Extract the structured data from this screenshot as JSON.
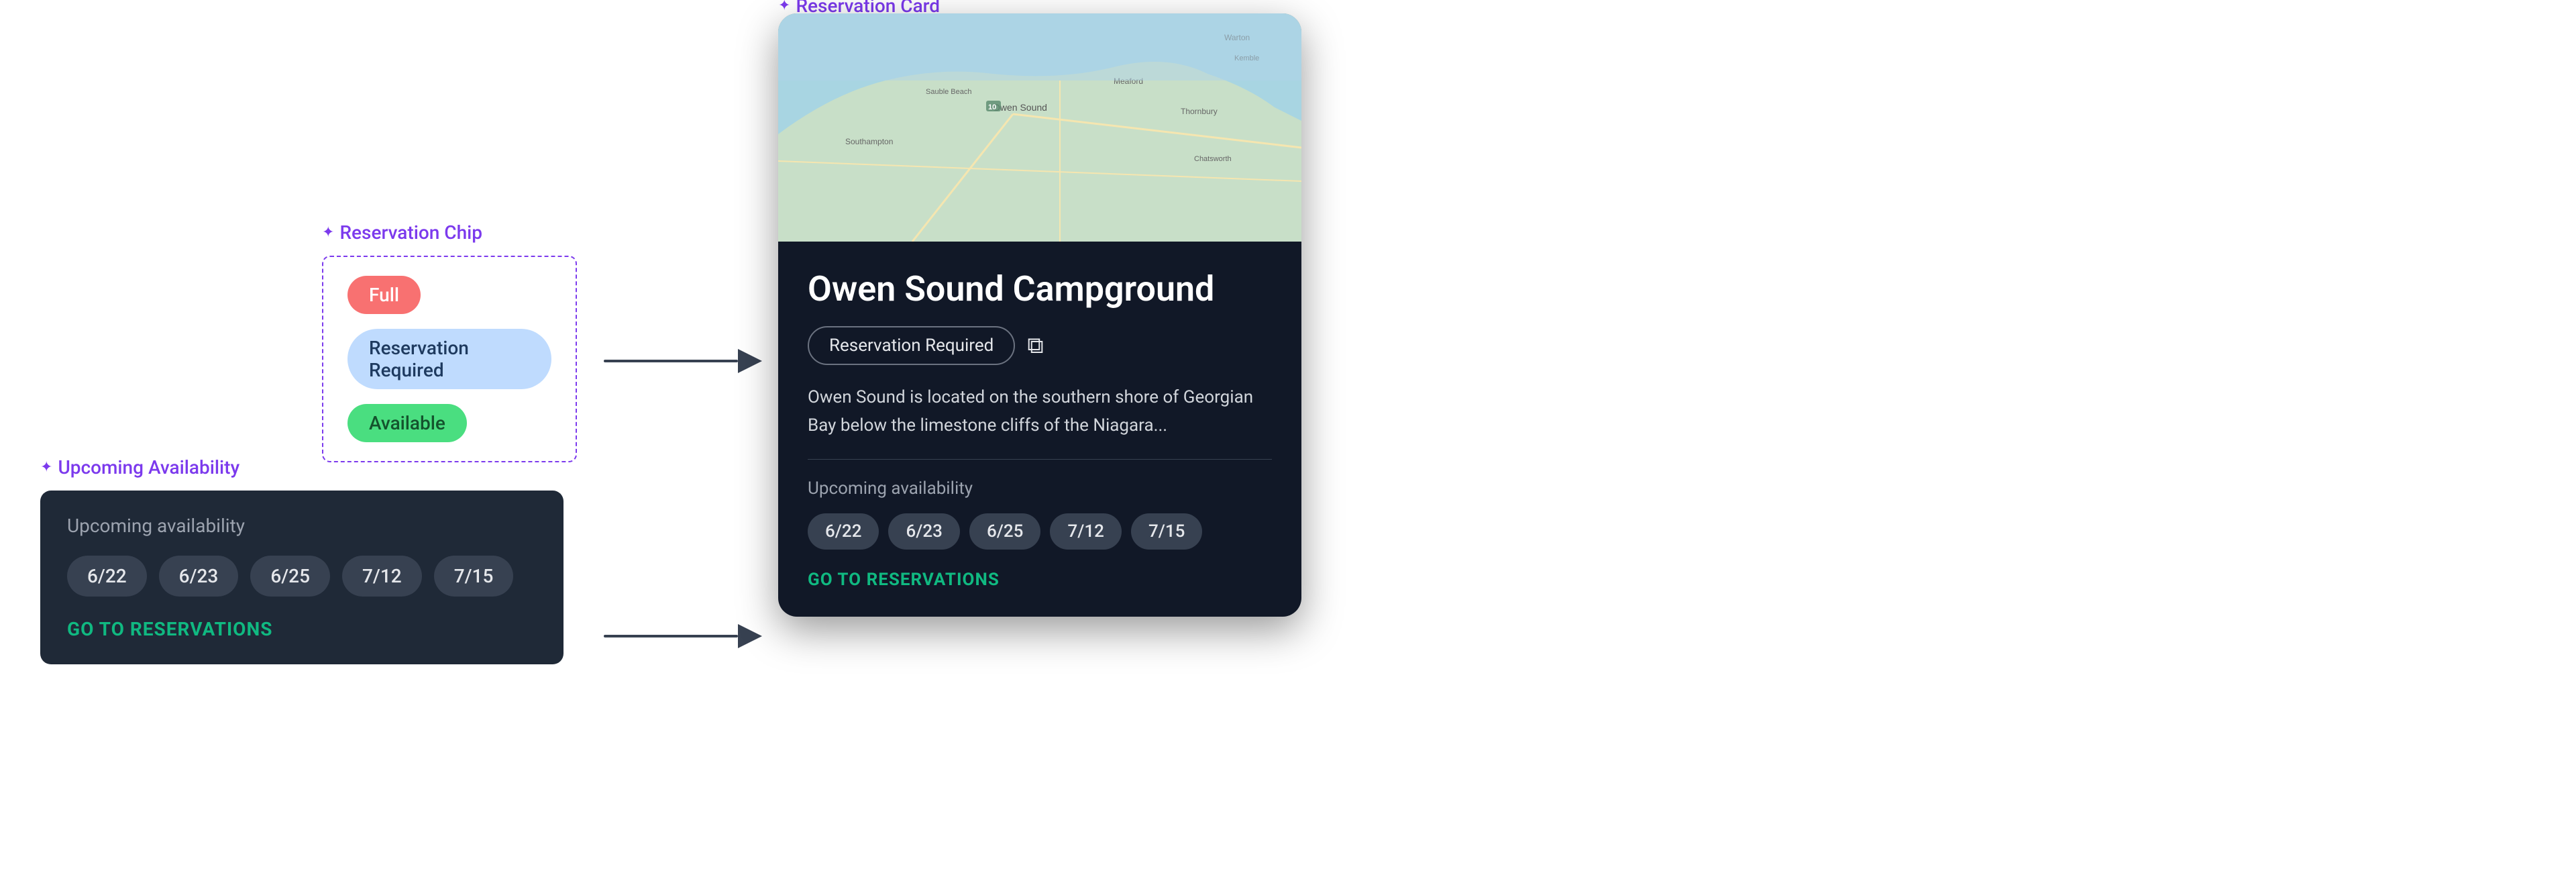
{
  "labels": {
    "chip_section": "Reservation Chip",
    "availability_section": "Upcoming Availability",
    "card_section": "Reservation Card"
  },
  "chips": {
    "full": "Full",
    "reservation": "Reservation Required",
    "available": "Available"
  },
  "availability": {
    "label": "Upcoming availability",
    "dates": [
      "6/22",
      "6/23",
      "6/25",
      "7/12",
      "7/15"
    ],
    "cta": "GO TO RESERVATIONS"
  },
  "reservation_card": {
    "title": "Owen Sound Campground",
    "chip_label": "Reservation Required",
    "description": "Owen Sound is located on the southern shore of Georgian Bay below the limestone cliffs of the Niagara...",
    "availability_label": "Upcoming availability",
    "dates": [
      "6/22",
      "6/23",
      "6/25",
      "7/12",
      "7/15"
    ],
    "cta": "GO TO RESERVATIONS"
  },
  "arrows": {
    "chip_to_card": "→",
    "avail_to_card": "→"
  }
}
